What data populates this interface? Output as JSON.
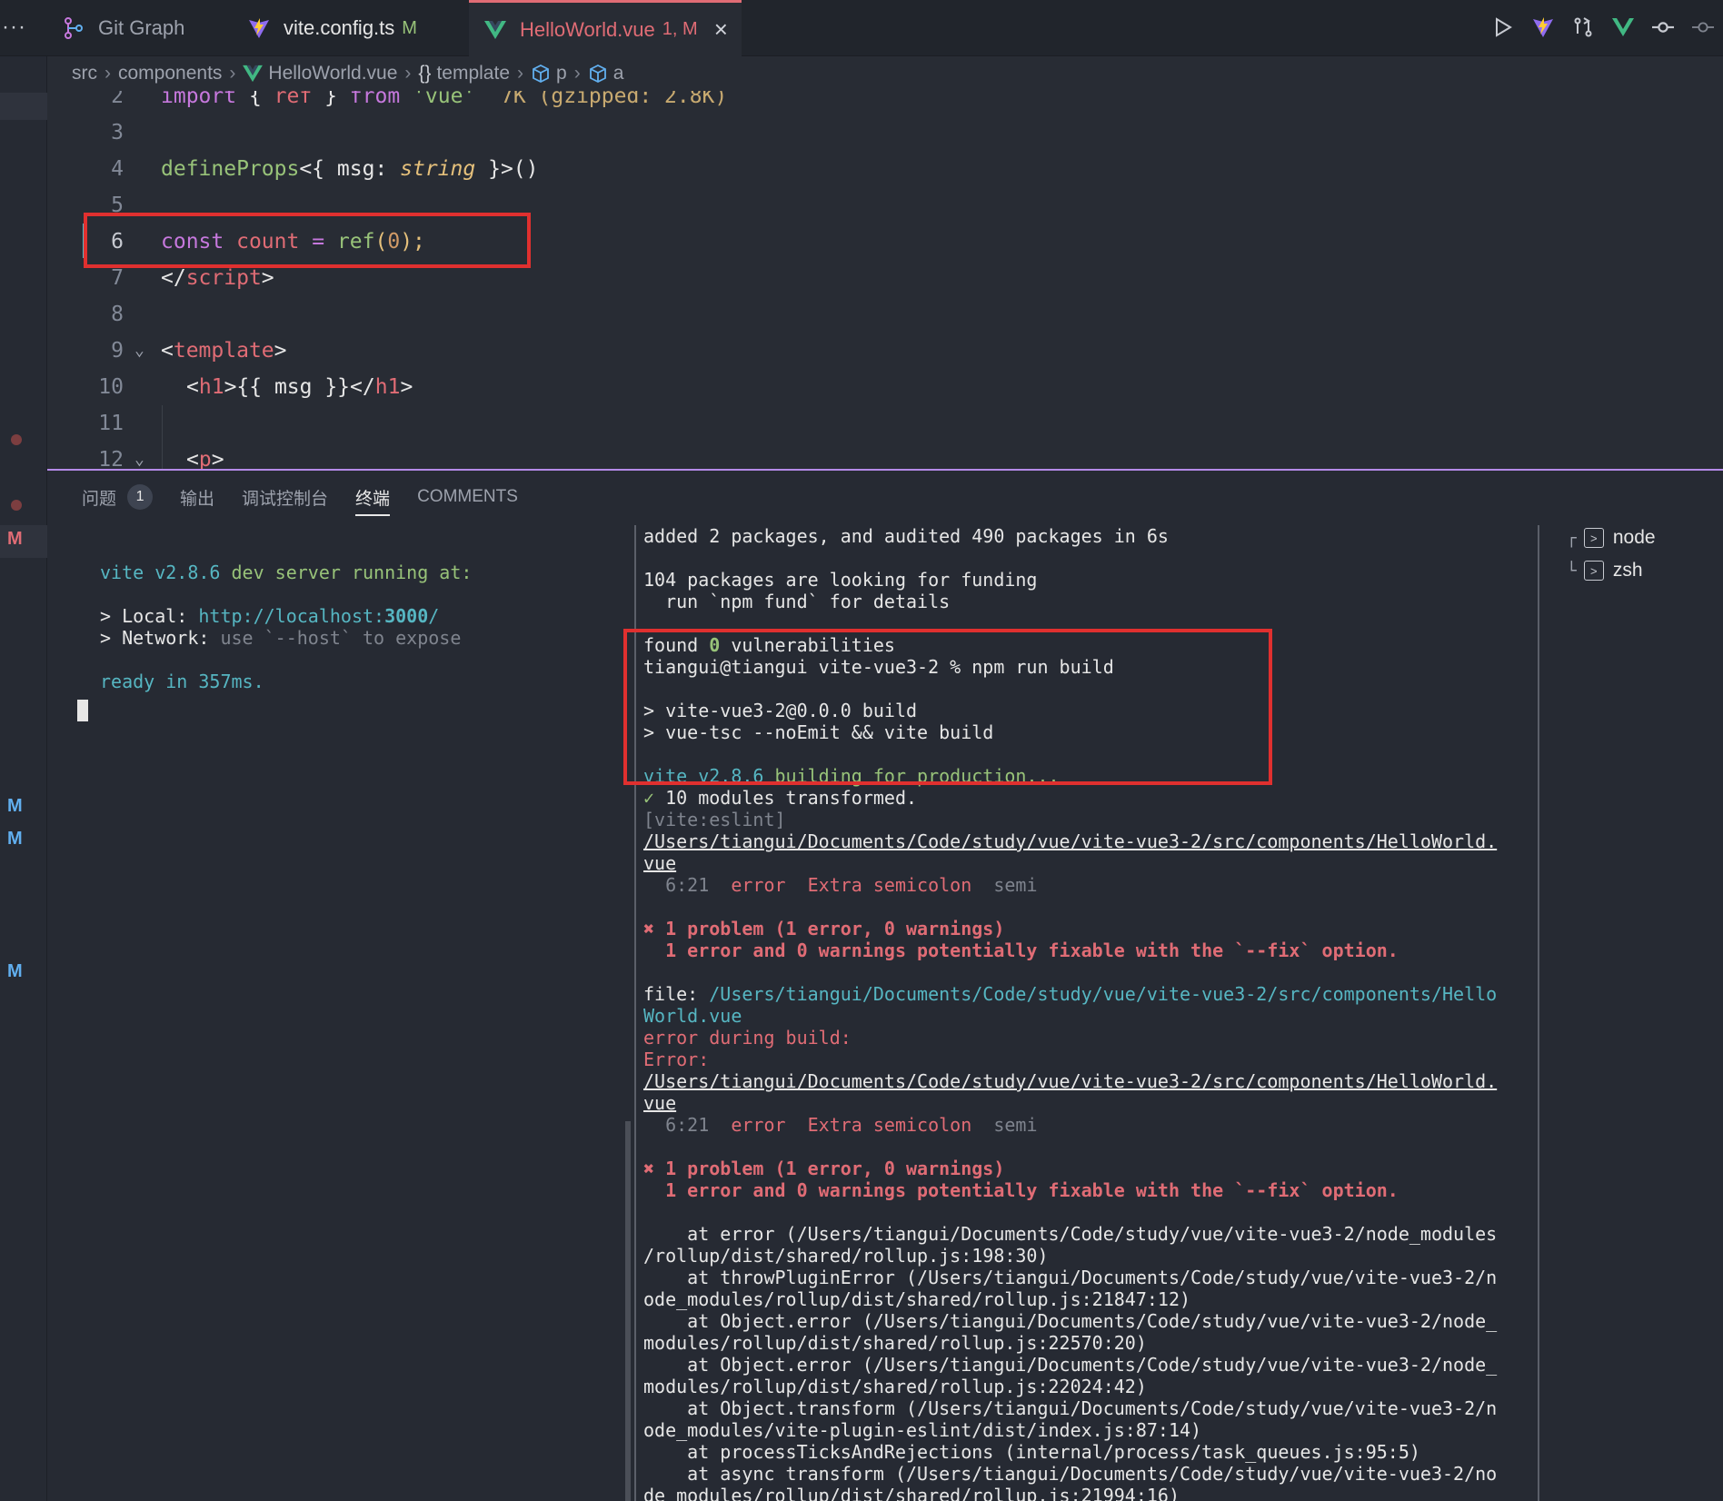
{
  "tabs": [
    {
      "label": "Git Graph",
      "status": "",
      "active": false,
      "icon": "git-graph-icon"
    },
    {
      "label": "vite.config.ts",
      "status": "M",
      "active": false,
      "icon": "vite-icon"
    },
    {
      "label": "HelloWorld.vue",
      "status": "1, M",
      "active": true,
      "icon": "vue-icon"
    }
  ],
  "breadcrumb": [
    "src",
    "components",
    "HelloWorld.vue",
    "template",
    "p",
    "a"
  ],
  "editor": {
    "lines": [
      {
        "n": "2",
        "hint": "7K (gzipped: 2.8K)"
      },
      {
        "n": "3"
      },
      {
        "n": "4"
      },
      {
        "n": "5"
      },
      {
        "n": "6"
      },
      {
        "n": "7"
      },
      {
        "n": "8"
      },
      {
        "n": "9"
      },
      {
        "n": "10"
      },
      {
        "n": "11"
      },
      {
        "n": "12"
      }
    ],
    "code": {
      "l2_import": "import",
      "l2_brace_open": "{",
      "l2_ref": "ref",
      "l2_brace_close": "}",
      "l2_from": "from",
      "l2_str": "'vue'",
      "l4_fn": "defineProps",
      "l4_open": "<{",
      "l4_msg": "msg:",
      "l4_type": "string",
      "l4_close": "}>()",
      "l6_const": "const",
      "l6_var": "count",
      "l6_eq": "=",
      "l6_ref": "ref",
      "l6_open": "(",
      "l6_num": "0",
      "l6_close": ");",
      "l7_open": "</",
      "l7_tag": "script",
      "l7_close": ">",
      "l9_open": "<",
      "l9_tag": "template",
      "l9_close": ">",
      "l10_open": "<",
      "l10_tag": "h1",
      "l10_mid": ">{{ msg }}</",
      "l10_tag2": "h1",
      "l10_close": ">",
      "l12_open": "<",
      "l12_tag": "p",
      "l12_close": ">"
    }
  },
  "panel": {
    "tabs": [
      {
        "label": "问题",
        "badge": "1"
      },
      {
        "label": "输出"
      },
      {
        "label": "调试控制台"
      },
      {
        "label": "终端",
        "active": true
      },
      {
        "label": "COMMENTS"
      }
    ]
  },
  "terminal_left": {
    "l1_a": "vite v2.8.6",
    "l1_b": " dev server running at:",
    "l2_a": "> Local: ",
    "l2_b": "http://localhost:",
    "l2_c": "3000",
    "l2_d": "/",
    "l3_a": "> Network: ",
    "l3_b": "use `--host` to expose",
    "l4_a": "ready in ",
    "l4_b": "357ms",
    "l4_c": "."
  },
  "terminal_mid": {
    "m1": "added 2 packages, and audited 490 packages in 6s",
    "m2": "104 packages are looking for funding",
    "m3": "  run `npm fund` for details",
    "m4_a": "found ",
    "m4_b": "0",
    "m4_c": " vulnerabilities",
    "m5": "tiangui@tiangui vite-vue3-2 % npm run build",
    "m6": "> vite-vue3-2@0.0.0 build",
    "m7": "> vue-tsc --noEmit && vite build",
    "m8_a": "vite v2.8.6",
    "m8_b": " building for production...",
    "m9_a": "✓",
    "m9_b": " 10 modules transformed.",
    "m10": "[vite:eslint]",
    "m11": "/Users/tiangui/Documents/Code/study/vue/vite-vue3-2/src/components/HelloWorld.",
    "m12": "vue",
    "m13_a": "  6:21  ",
    "m13_b": "error",
    "m13_c": "  Extra semicolon  ",
    "m13_d": "semi",
    "m14": "✖ 1 problem (1 error, 0 warnings)",
    "m15": "  1 error and 0 warnings potentially fixable with the `--fix` option.",
    "m16_a": "file: ",
    "m16_b": "/Users/tiangui/Documents/Code/study/vue/vite-vue3-2/src/components/Hello",
    "m17": "World.vue",
    "m18": "error during build:",
    "m19": "Error:",
    "m20": "/Users/tiangui/Documents/Code/study/vue/vite-vue3-2/src/components/HelloWorld.",
    "m21": "vue",
    "m22_a": "  6:21  ",
    "m22_b": "error",
    "m22_c": "  Extra semicolon  ",
    "m22_d": "semi",
    "m23": "✖ 1 problem (1 error, 0 warnings)",
    "m24": "  1 error and 0 warnings potentially fixable with the `--fix` option.",
    "m25": "    at error (/Users/tiangui/Documents/Code/study/vue/vite-vue3-2/node_modules",
    "m26": "/rollup/dist/shared/rollup.js:198:30)",
    "m27": "    at throwPluginError (/Users/tiangui/Documents/Code/study/vue/vite-vue3-2/n",
    "m28": "ode_modules/rollup/dist/shared/rollup.js:21847:12)",
    "m29": "    at Object.error (/Users/tiangui/Documents/Code/study/vue/vite-vue3-2/node_",
    "m30": "modules/rollup/dist/shared/rollup.js:22570:20)",
    "m31": "    at Object.error (/Users/tiangui/Documents/Code/study/vue/vite-vue3-2/node_",
    "m32": "modules/rollup/dist/shared/rollup.js:22024:42)",
    "m33": "    at Object.transform (/Users/tiangui/Documents/Code/study/vue/vite-vue3-2/n",
    "m34": "ode_modules/vite-plugin-eslint/dist/index.js:87:14)",
    "m35": "    at processTicksAndRejections (internal/process/task_queues.js:95:5)",
    "m36": "    at async transform (/Users/tiangui/Documents/Code/study/vue/vite-vue3-2/no",
    "m37": "de_modules/rollup/dist/shared/rollup.js:21994:16)"
  },
  "terminal_list": [
    {
      "label": "node"
    },
    {
      "label": "zsh"
    }
  ],
  "activity_marks": [
    "M",
    "M",
    "M",
    "M"
  ],
  "colors": {
    "accent": "#b48ae8",
    "active_tab": "#e06c75",
    "highlight_box": "#e0302f"
  }
}
